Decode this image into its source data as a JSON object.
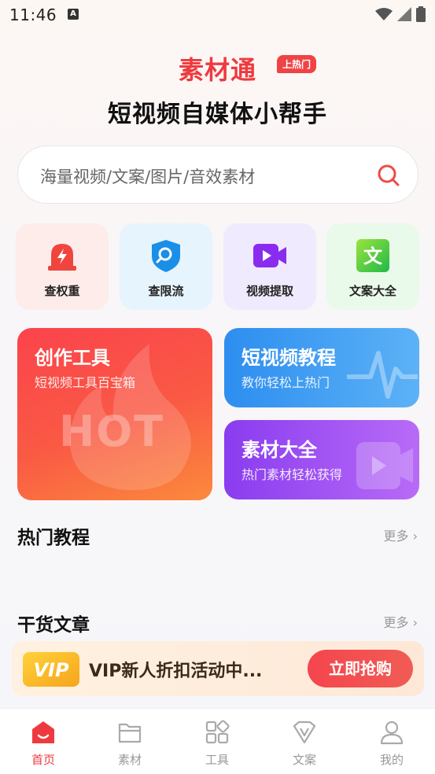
{
  "status": {
    "time": "11:46",
    "notif": "A"
  },
  "brand": {
    "title": "素材通",
    "badge": "上热门",
    "subtitle": "短视频自媒体小帮手"
  },
  "search": {
    "placeholder": "海量视频/文案/图片/音效素材"
  },
  "quick_actions": [
    {
      "label": "查权重",
      "icon": "alarm-lightning-icon",
      "bg": "#fdecea"
    },
    {
      "label": "查限流",
      "icon": "shield-search-icon",
      "bg": "#e6f4fd"
    },
    {
      "label": "视频提取",
      "icon": "video-camera-icon",
      "bg": "#efeafd"
    },
    {
      "label": "文案大全",
      "icon": "text-wen-icon",
      "bg": "#e9f9ea"
    }
  ],
  "cards": {
    "tools": {
      "title": "创作工具",
      "subtitle": "短视频工具百宝箱",
      "watermark": "HOT"
    },
    "tutorial": {
      "title": "短视频教程",
      "subtitle": "教你轻松上热门"
    },
    "materials": {
      "title": "素材大全",
      "subtitle": "热门素材轻松获得"
    }
  },
  "sections": {
    "hot_tutorials": {
      "title": "热门教程",
      "more": "更多"
    },
    "articles": {
      "title": "干货文章",
      "more": "更多"
    }
  },
  "vip": {
    "logo": "VIP",
    "text": "VIP新人折扣活动中...",
    "button": "立即抢购"
  },
  "tabs": [
    {
      "label": "首页",
      "icon": "home-icon",
      "active": true
    },
    {
      "label": "素材",
      "icon": "folder-icon",
      "active": false
    },
    {
      "label": "工具",
      "icon": "grid-icon",
      "active": false
    },
    {
      "label": "文案",
      "icon": "diamond-v-icon",
      "active": false
    },
    {
      "label": "我的",
      "icon": "user-icon",
      "active": false
    }
  ],
  "colors": {
    "accent": "#ee3a3f",
    "blue": "#3d9bf2",
    "purple": "#8a3cf0"
  }
}
